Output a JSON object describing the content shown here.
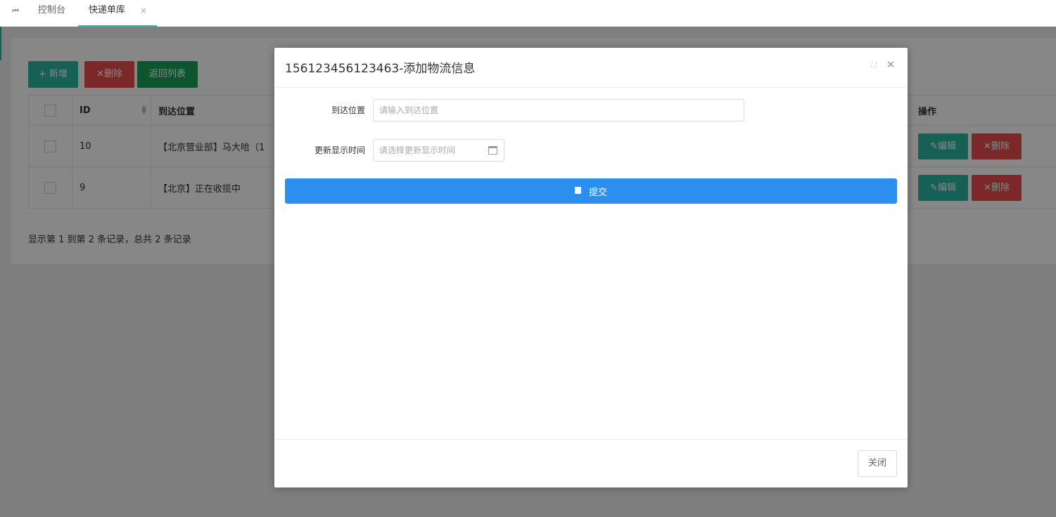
{
  "tabs": {
    "first_icon": "⏮",
    "items": [
      {
        "label": "控制台"
      },
      {
        "label": "快递单库",
        "close": "×"
      }
    ]
  },
  "toolbar": {
    "add_label": "+ 新增",
    "delete_label": "✕删除",
    "back_label": "返回列表"
  },
  "table": {
    "headers": {
      "id": "ID",
      "position": "到达位置",
      "ops": "操作"
    },
    "rows": [
      {
        "id": "10",
        "position": "【北京营业部】马大哈（1"
      },
      {
        "id": "9",
        "position": "【北京】正在收揽中"
      }
    ],
    "edit_label": "编辑",
    "delete_label": "✕删除",
    "summary": "显示第 1 到第 2 条记录，总共 2 条记录"
  },
  "modal": {
    "title": "156123456123463-添加物流信息",
    "fields": {
      "position_label": "到达位置",
      "position_placeholder": "请输入到达位置",
      "time_label": "更新显示时间",
      "time_placeholder": "请选择更新显示时间"
    },
    "submit_label": "提交",
    "close_label": "关闭"
  },
  "colors": {
    "accent": "#2ab5a3",
    "danger": "#e64c4c",
    "success": "#18a058",
    "primary": "#2c8ff0"
  }
}
